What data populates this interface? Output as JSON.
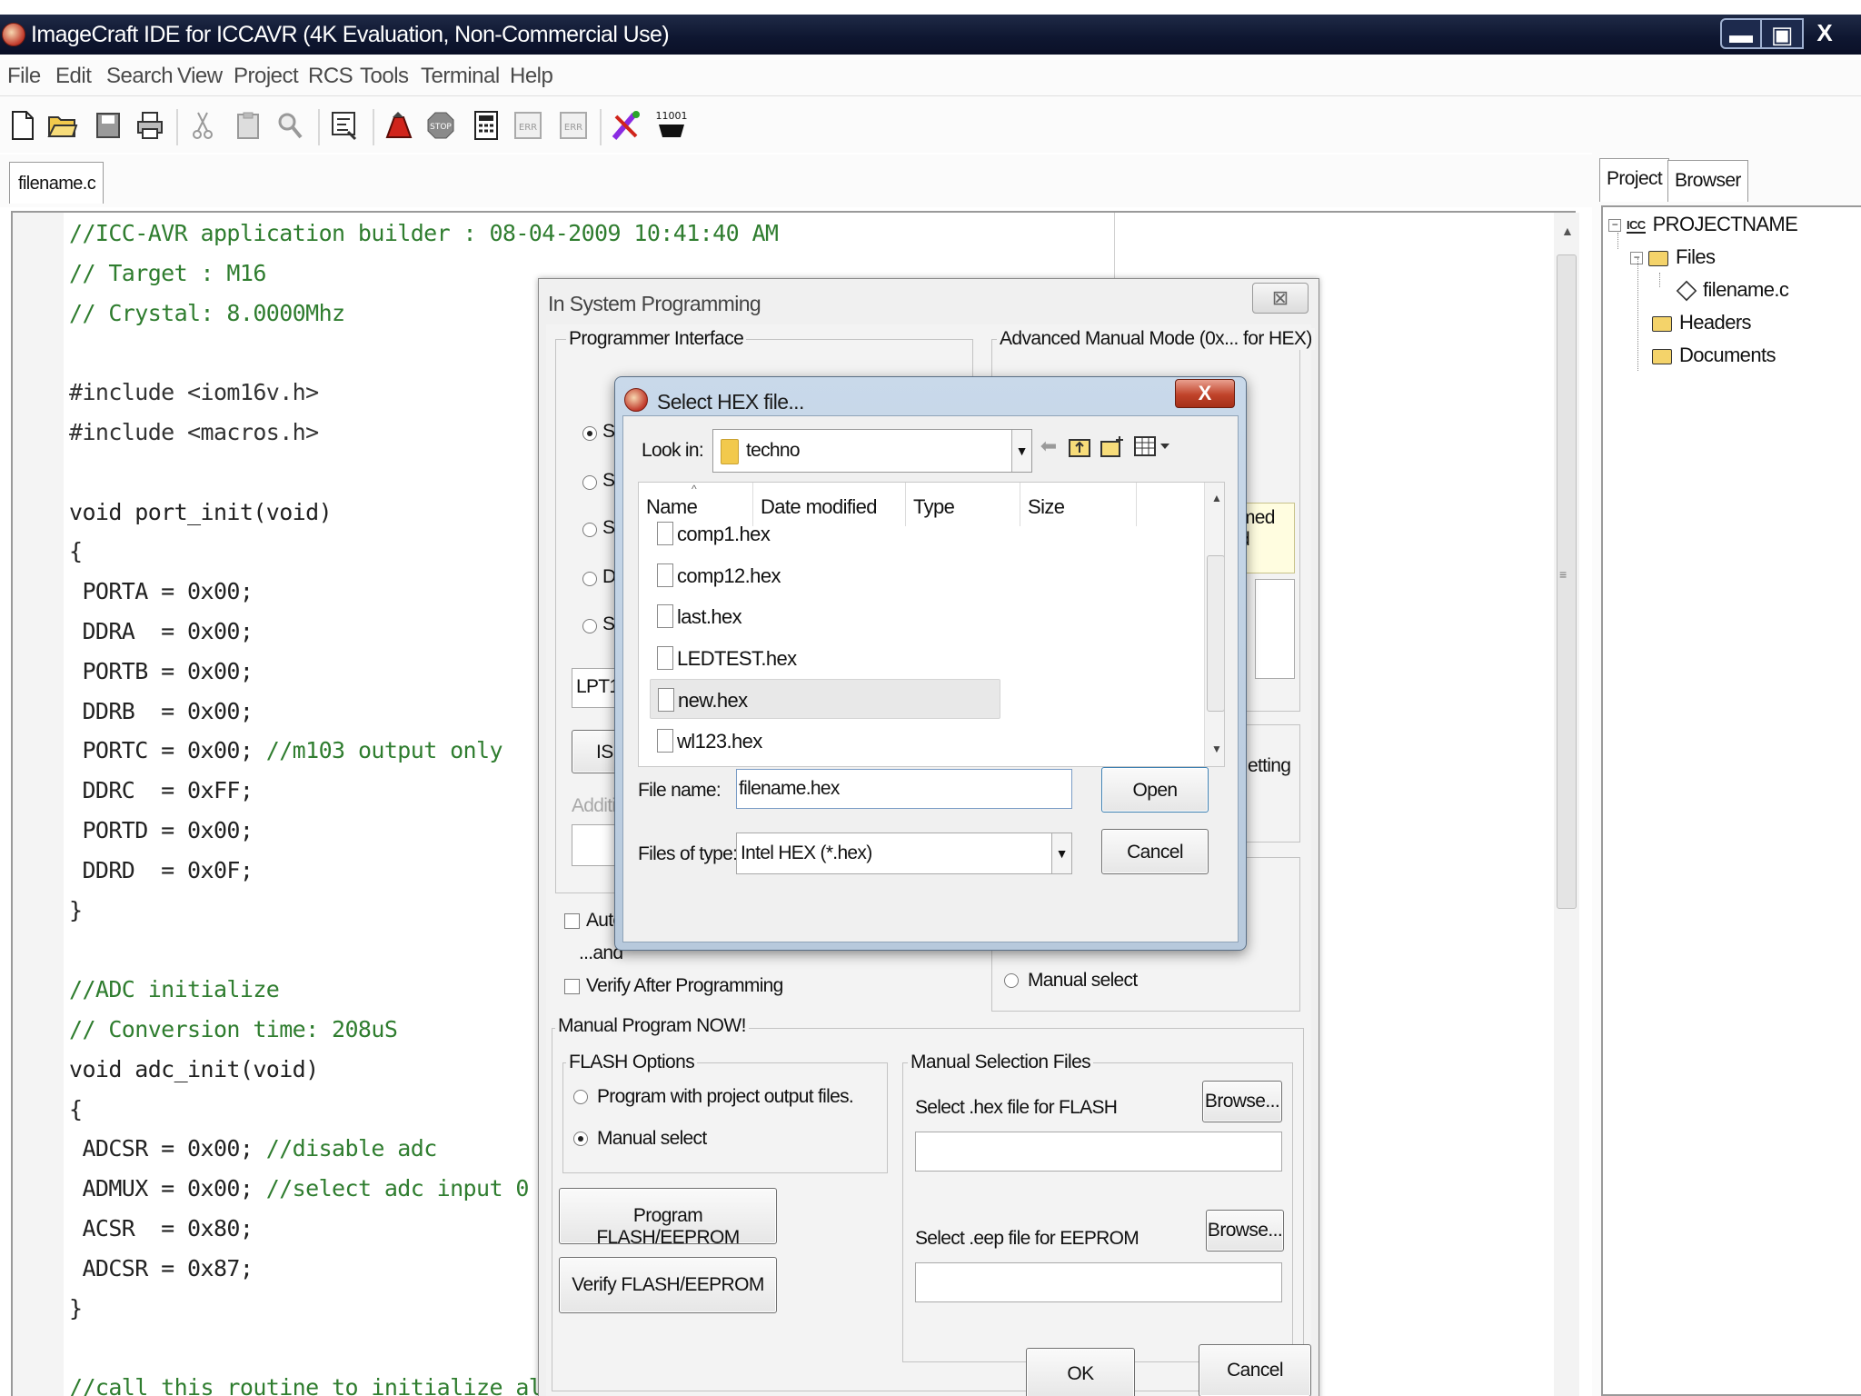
{
  "window": {
    "title": "ImageCraft IDE for ICCAVR (4K Evaluation, Non-Commercial Use)",
    "min_glyph": "▬",
    "max_glyph": "▣",
    "close_glyph": "X"
  },
  "menu": [
    "File",
    "Edit",
    "Search",
    "View",
    "Project",
    "RCS",
    "Tools",
    "Terminal",
    "Help"
  ],
  "toolbar": {
    "icons": [
      "new-file-icon",
      "open-folder-icon",
      "save-icon",
      "print-icon",
      "cut-icon",
      "paste-icon",
      "find-icon",
      "options-icon",
      "build-icon",
      "stop-icon",
      "calculator-icon",
      "error-prev-icon",
      "error-next-icon",
      "isp-program-icon",
      "terminal-icon"
    ],
    "terminal_label": "11001"
  },
  "editor": {
    "tab": "filename.c",
    "lines": [
      {
        "text": "//ICC-AVR application builder : 08-04-2009 10:41:40 AM",
        "kind": "comment"
      },
      {
        "text": "// Target : M16",
        "kind": "comment"
      },
      {
        "text": "// Crystal: 8.0000Mhz",
        "kind": "comment"
      },
      {
        "text": "",
        "kind": "code"
      },
      {
        "text": "#include <iom16v.h>",
        "kind": "directive"
      },
      {
        "text": "#include <macros.h>",
        "kind": "directive"
      },
      {
        "text": "",
        "kind": "code"
      },
      {
        "text": "void port_init(void)",
        "kind": "code"
      },
      {
        "text": "{",
        "kind": "code"
      },
      {
        "text": " PORTA = 0x00;",
        "kind": "code"
      },
      {
        "text": " DDRA  = 0x00;",
        "kind": "code"
      },
      {
        "text": " PORTB = 0x00;",
        "kind": "code"
      },
      {
        "text": " DDRB  = 0x00;",
        "kind": "code"
      },
      {
        "text": " PORTC = 0x00; //m103 output only",
        "kind": "mixed",
        "code": " PORTC = 0x00; ",
        "comment": "//m103 output only"
      },
      {
        "text": " DDRC  = 0xFF;",
        "kind": "code"
      },
      {
        "text": " PORTD = 0x00;",
        "kind": "code"
      },
      {
        "text": " DDRD  = 0x0F;",
        "kind": "code"
      },
      {
        "text": "}",
        "kind": "code"
      },
      {
        "text": "",
        "kind": "code"
      },
      {
        "text": "//ADC initialize",
        "kind": "comment"
      },
      {
        "text": "// Conversion time: 208uS",
        "kind": "comment"
      },
      {
        "text": "void adc_init(void)",
        "kind": "code"
      },
      {
        "text": "{",
        "kind": "code"
      },
      {
        "text": " ADCSR = 0x00; //disable adc",
        "kind": "mixed",
        "code": " ADCSR = 0x00; ",
        "comment": "//disable adc"
      },
      {
        "text": " ADMUX = 0x00; //select adc input 0",
        "kind": "mixed",
        "code": " ADMUX = 0x00; ",
        "comment": "//select adc input 0"
      },
      {
        "text": " ACSR  = 0x80;",
        "kind": "code"
      },
      {
        "text": " ADCSR = 0x87;",
        "kind": "code"
      },
      {
        "text": "}",
        "kind": "code"
      },
      {
        "text": "",
        "kind": "code"
      },
      {
        "text": "//call this routine to initialize al",
        "kind": "comment"
      }
    ]
  },
  "right_panel": {
    "tabs": [
      "Project",
      "Browser"
    ],
    "tree": {
      "root": "PROJECTNAME",
      "root_logo": "ICC",
      "files_folder": "Files",
      "file": "filename.c",
      "headers": "Headers",
      "documents": "Documents"
    }
  },
  "isp_dialog": {
    "title": "In System Programming",
    "programmer_interface": "Programmer Interface",
    "advanced_mode": "Advanced Manual Mode (0x... for HEX)",
    "radio_fragments": [
      "S",
      "S",
      "S",
      "D",
      "S"
    ],
    "port_value": "LPT1",
    "isp_button_fragment": "ISF",
    "additional_fragment": "Additi",
    "auto_fragment": "Auto",
    "and_selected_fragment": "...and",
    "hint_fragment_1": "med",
    "hint_fragment_2": "d",
    "setting_fragment": "etting",
    "manual_select_right": "Manual select",
    "verify_after": "Verify After Programming",
    "manual_program_now": "Manual Program NOW!",
    "flash_options": "FLASH Options",
    "opt_project_output": "Program with project output files.",
    "opt_manual_select": "Manual select",
    "manual_selection_files": "Manual Selection Files",
    "select_hex_flash": "Select .hex file for FLASH",
    "select_eep_eeprom": "Select .eep file for EEPROM",
    "browse": "Browse...",
    "program_flash": "Program FLASH/EEPROM",
    "verify_flash": "Verify FLASH/EEPROM",
    "ok": "OK",
    "cancel": "Cancel"
  },
  "hex_dialog": {
    "title": "Select HEX file...",
    "look_in_label": "Look in:",
    "look_in_value": "techno",
    "columns": [
      "Name",
      "Date modified",
      "Type",
      "Size"
    ],
    "files": [
      "comp1.hex",
      "comp12.hex",
      "last.hex",
      "LEDTEST.hex",
      "new.hex",
      "wl123.hex"
    ],
    "selected_file": "new.hex",
    "file_name_label": "File name:",
    "file_name_value": "filename.hex",
    "files_of_type_label": "Files of type:",
    "files_of_type_value": "Intel HEX (*.hex)",
    "open": "Open",
    "cancel": "Cancel"
  }
}
